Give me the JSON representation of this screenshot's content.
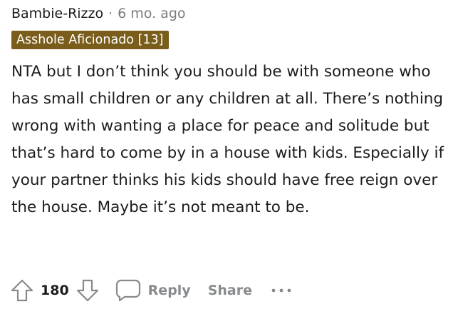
{
  "comment": {
    "author": "Bambie-Rizzo",
    "separator": "·",
    "timestamp": "6 mo. ago",
    "flair": "Asshole Aficionado [13]",
    "body": "NTA but I don’t think you should be with someone who has small children or any children at all. There’s nothing wrong with wanting a place for peace and solitude but that’s hard to come by in a house with kids. Especially if your partner thinks his kids should have free reign over the house. Maybe it’s not meant to be."
  },
  "actions": {
    "upvote_icon": "upvote-arrow-icon",
    "vote_count": "180",
    "downvote_icon": "downvote-arrow-icon",
    "reply_icon": "speech-bubble-icon",
    "reply_label": "Reply",
    "share_label": "Share",
    "more_icon": "ellipsis-icon"
  },
  "colors": {
    "flair_background": "#7a5d1b",
    "flair_text": "#ffffff",
    "muted_text": "#7c7c7c",
    "action_text": "#878a8c",
    "body_text": "#1c1c1c"
  }
}
